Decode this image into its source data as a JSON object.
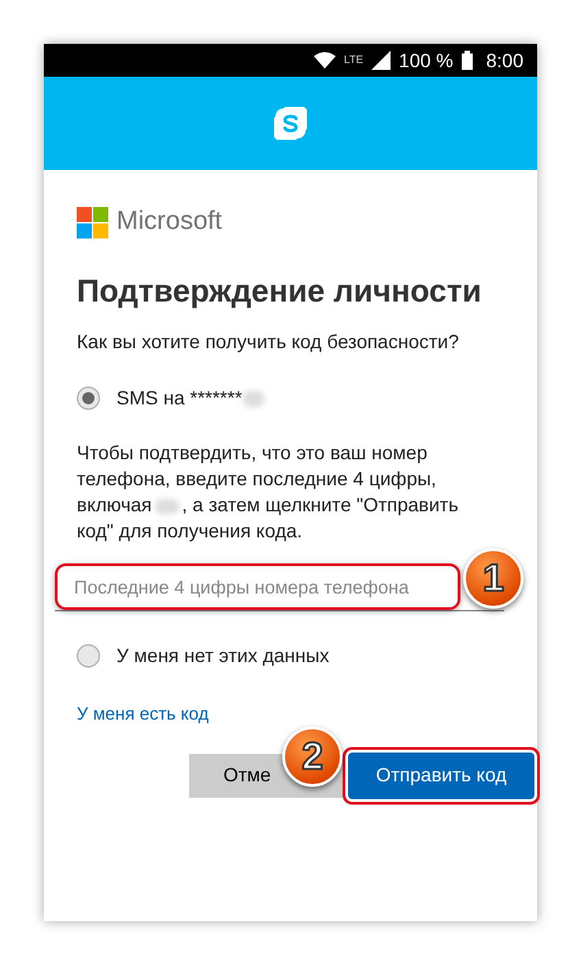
{
  "status_bar": {
    "network": "LTE",
    "battery": "100 %",
    "time": "8:00"
  },
  "brand": "Microsoft",
  "title": "Подтверждение личности",
  "question": "Как вы хотите получить код безопасности?",
  "options": [
    {
      "label": "SMS на *******",
      "selected": true
    },
    {
      "label": "У меня нет этих данных",
      "selected": false
    }
  ],
  "instructions": [
    "Чтобы подтвердить, что это ваш номер телефона, введите последние 4 цифры, включая",
    ", а затем щелкните \"Отправить код\" для получения кода."
  ],
  "code_input": {
    "placeholder": "Последние 4 цифры номера телефона"
  },
  "link": "У меня есть код",
  "buttons": {
    "cancel": "Отме",
    "submit": "Отправить код"
  },
  "annotations": [
    {
      "number": "1"
    },
    {
      "number": "2"
    }
  ]
}
